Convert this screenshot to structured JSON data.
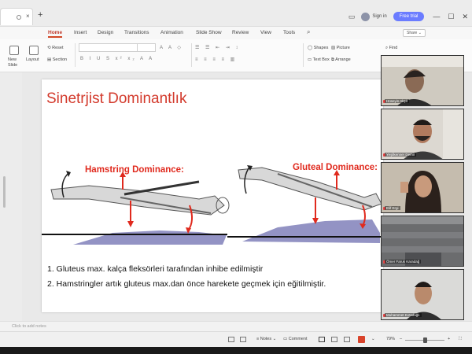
{
  "tabs": {
    "document_tab_close": "×",
    "new_tab": "+"
  },
  "titlebar": {
    "sign_in": "Sign in",
    "free_trial": "Free trial",
    "min": "—",
    "max": "☐",
    "close": "✕"
  },
  "menu": {
    "items": [
      "Home",
      "Insert",
      "Design",
      "Transitions",
      "Animation",
      "Slide Show",
      "Review",
      "View",
      "Tools"
    ],
    "share": "Share ⌄"
  },
  "ribbon": {
    "new_slide": "New Slide",
    "layout": "Layout",
    "reset": "Reset",
    "section": "Section",
    "shapes": "Shapes",
    "picture": "Picture",
    "textbox": "Text Box",
    "arrange": "Arrange",
    "find": "Find"
  },
  "slide": {
    "title": "Sinetrjist Dominantlık",
    "panel_left_title": "Hamstring Dominance:",
    "panel_right_title": "Gluteal Dominance:",
    "list": [
      "1. Gluteus max. kalça fleksörleri tarafından inhibe edilmiştir",
      "2. Hamstringler artık gluteus max.dan önce harekete geçmek için eğitilmiştir."
    ]
  },
  "notes": {
    "placeholder": "Click to add notes"
  },
  "status": {
    "notes": "Notes",
    "comment": "Comment",
    "zoom": "79%"
  },
  "video": {
    "participants": [
      {
        "name": "Hüseyin Akşit",
        "bg": "#c9c4b8"
      },
      {
        "name": "Yeşilkenner Demir",
        "bg": "#d7d2ca"
      },
      {
        "name": "Elif Ergi",
        "bg": "#bfb6a8"
      },
      {
        "name": "Ömer Faruk Karadağ",
        "bg": "#6d6f72"
      },
      {
        "name": "Muhammet Kızadağlı",
        "bg": "#d8d8d6"
      }
    ]
  },
  "colors": {
    "accent": "#d24726",
    "slide_title": "#d33a2c",
    "trial": "#6b7cff"
  }
}
